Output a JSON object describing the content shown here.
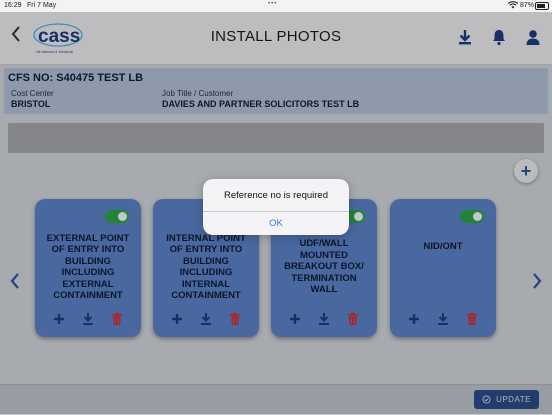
{
  "status_bar": {
    "time": "16:29",
    "date": "Fri 7 May",
    "dots": "•••",
    "battery": "87%"
  },
  "header": {
    "title": "INSTALL PHOTOS",
    "back_icon": "chevron-left-icon",
    "logo_text": "cass",
    "logo_tagline": "cfs telecom & electrical",
    "actions": [
      "download-icon",
      "bell-icon",
      "user-icon"
    ]
  },
  "job": {
    "cfs_no": "CFS NO: S40475 TEST LB",
    "cost_center_label": "Cost Center",
    "cost_center": "BRISTOL",
    "job_title_label": "Job Title / Customer",
    "job_title": "DAVIES AND PARTNER SOLICITORS TEST LB"
  },
  "cards": [
    {
      "title": "EXTERNAL POINT OF ENTRY INTO BUILDING INCLUDING EXTERNAL CONTAINMENT",
      "enabled": true
    },
    {
      "title": "INTERNAL POINT OF ENTRY INTO BUILDING INCLUDING INTERNAL CONTAINMENT",
      "enabled": true
    },
    {
      "title": "UDF/WALL MOUNTED BREAKOUT BOX/ TERMINATION WALL",
      "enabled": true
    },
    {
      "title": "NID/ONT",
      "enabled": true
    }
  ],
  "alert": {
    "message": "Reference no is required",
    "ok_label": "OK"
  },
  "footer": {
    "update_label": "UPDATE"
  },
  "colors": {
    "card": "#5f86ce",
    "toggle_on": "#2ea84a",
    "primary": "#2f57a6",
    "delete": "#d9312f",
    "update_button": "#2c4f8c"
  }
}
